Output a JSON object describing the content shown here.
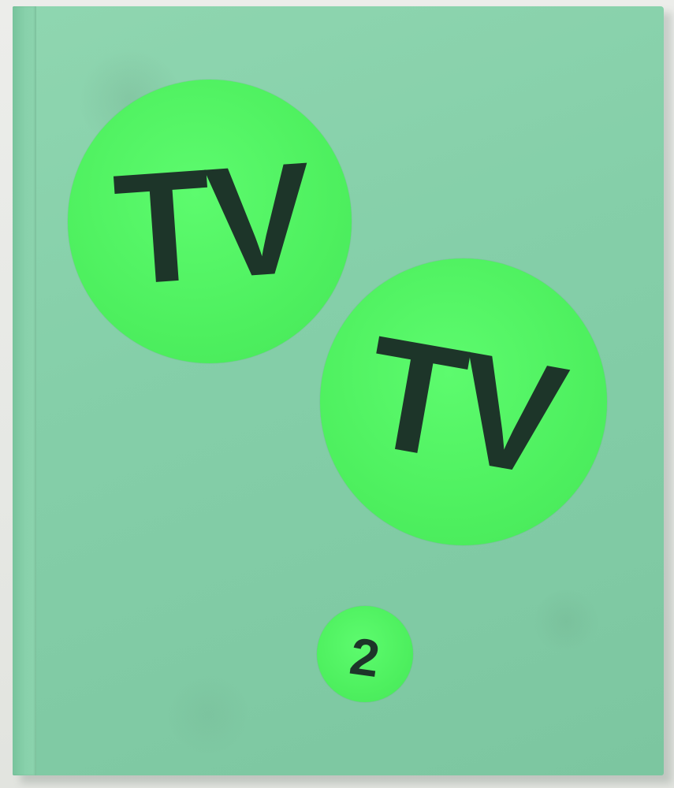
{
  "cover": {
    "background_color": "#85cfa9",
    "sticker_color": "#4ef05f",
    "text_color": "#1d3529",
    "sticker_top_text": "TV",
    "sticker_middle_text": "TV",
    "sticker_number_text": "2"
  }
}
